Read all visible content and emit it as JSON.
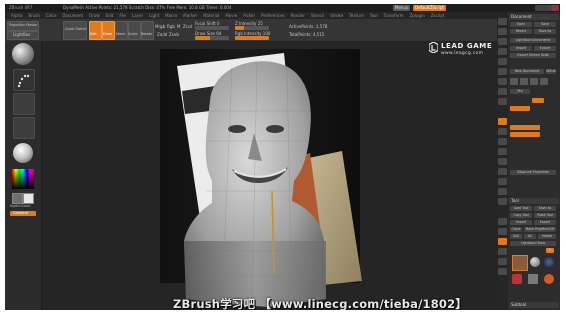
{
  "titlebar": {
    "title": "ZBrush 4R7",
    "info": "DynaMesh   Active Points: 21,578   Scratch Disk: 47%   Free Mem: 10.8 GB   Timer: 0.004",
    "menus_btn": "Menus",
    "default_btn": "DefaultZScript"
  },
  "menubar": {
    "items": [
      "Alpha",
      "Brush",
      "Color",
      "Document",
      "Draw",
      "Edit",
      "File",
      "Layer",
      "Light",
      "Macro",
      "Marker",
      "Material",
      "Movie",
      "Picker",
      "Preferences",
      "Render",
      "Stencil",
      "Stroke",
      "Texture",
      "Tool",
      "Transform",
      "Zplugin",
      "Zscript"
    ]
  },
  "toolbar": {
    "projection_master": "Projection Master",
    "lightbox": "LightBox",
    "quick_sketch": "Quick Sketch",
    "edit": "Edit",
    "draw": "Draw",
    "move": "Move",
    "scale": "Scale",
    "rotate": "Rotate",
    "mrgb": "Mrgb",
    "rgb": "Rgb",
    "m": "M",
    "zadd": "Zadd",
    "zsub": "Zsub",
    "zcut": "Zcut",
    "focal_shift": "Focal Shift 0",
    "draw_size": "Draw Size 64",
    "z_intensity": "Z Intensity 25",
    "rgb_intensity": "Rgb Intensity 100",
    "active_points": "ActivePoints: 2,578",
    "total_points": "TotalPoints: 4,515",
    "focal_value": 0.0,
    "draw_size_value": 0.45,
    "z_intensity_value": 0.25,
    "rgb_intensity_value": 1.0
  },
  "leftshelf": {
    "switch_color": "SwitchColor",
    "gradient": "Gradient"
  },
  "logo": {
    "name": "LEAD GAME",
    "url": "www.leagcg.com"
  },
  "rightpanel": {
    "document": "Document",
    "open": "Open",
    "save": "Save",
    "revert": "Revert",
    "save_as": "Save As",
    "lightbox_documents": "LightBox>Documents",
    "import": "Import",
    "export": "Export",
    "export_screen_grab": "Export Screen Grab",
    "new_document": "New Document",
    "wsize": "WSize",
    "pro": "Pro",
    "zapplink_properties": "ZAppLink Properties",
    "tool": "Tool",
    "load_tool": "Load Tool",
    "save_as_tool": "Save As",
    "copy_tool": "Copy Tool",
    "paste_tool": "Paste Tool",
    "import_tool": "Import",
    "export_tool": "Export",
    "clone": "Clone",
    "make_polymesh3d": "Make PolyMesh3D",
    "goz": "GoZ",
    "all": "All",
    "visible": "Visible",
    "lightbox_tools": "Lightbox>Tools",
    "subtool": "Subtool",
    "r": "R"
  },
  "watermark": "ZBrush学习吧   【www.linecg.com/tieba/1802】",
  "colors": {
    "accent": "#e07a1e",
    "background": "#2f2f2f",
    "canvas": "#252525"
  }
}
